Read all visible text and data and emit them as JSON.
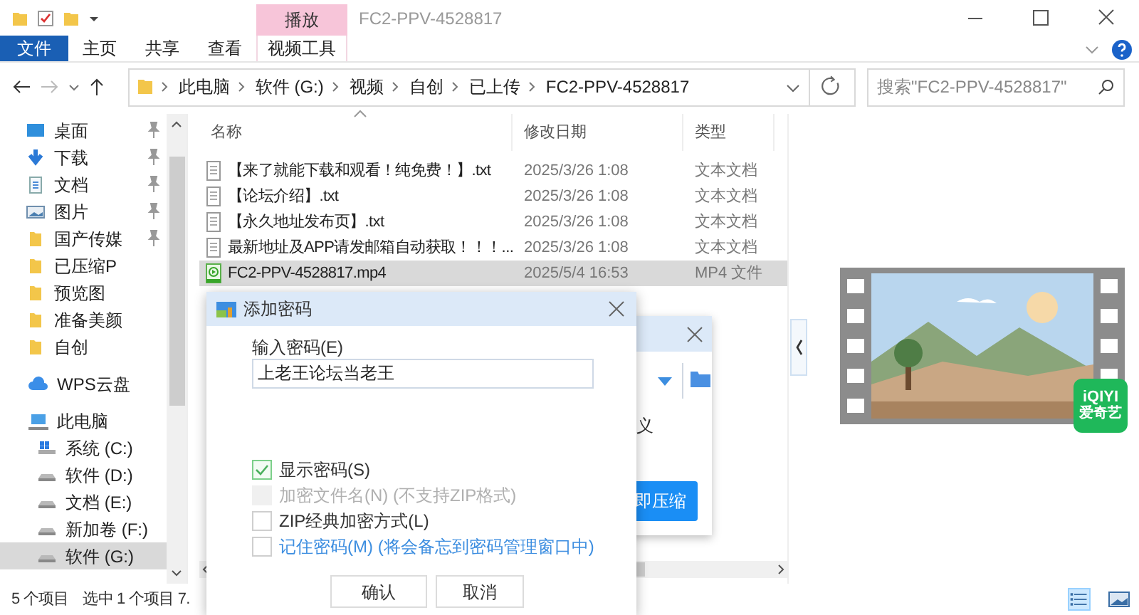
{
  "window": {
    "title": "FC2-PPV-4528817",
    "contextual_group": "播放"
  },
  "ribbon_tabs": [
    {
      "label": "文件",
      "kind": "file",
      "selected": false
    },
    {
      "label": "主页",
      "kind": "tab",
      "selected": false
    },
    {
      "label": "共享",
      "kind": "tab",
      "selected": false
    },
    {
      "label": "查看",
      "kind": "tab",
      "selected": false
    },
    {
      "label": "视频工具",
      "kind": "contextual",
      "selected": false
    }
  ],
  "address": {
    "segments": [
      "此电脑",
      "软件 (G:)",
      "视频",
      "自创",
      "已上传",
      "FC2-PPV-4528817"
    ]
  },
  "search": {
    "placeholder": "搜索\"FC2-PPV-4528817\""
  },
  "sidebar": {
    "items": [
      {
        "label": "桌面",
        "kind": "desktop",
        "pinned": true,
        "selected": false
      },
      {
        "label": "下载",
        "kind": "download",
        "pinned": true,
        "selected": false
      },
      {
        "label": "文档",
        "kind": "document",
        "pinned": true,
        "selected": false
      },
      {
        "label": "图片",
        "kind": "pictures",
        "pinned": true,
        "selected": false
      },
      {
        "label": "国产传媒",
        "kind": "folder",
        "pinned": true,
        "selected": false
      },
      {
        "label": "已压缩P",
        "kind": "folder",
        "pinned": false,
        "selected": false
      },
      {
        "label": "预览图",
        "kind": "folder",
        "pinned": false,
        "selected": false
      },
      {
        "label": "准备美颜",
        "kind": "folder",
        "pinned": false,
        "selected": false
      },
      {
        "label": "自创",
        "kind": "folder",
        "pinned": false,
        "selected": false
      },
      {
        "label": "WPS云盘",
        "kind": "cloud",
        "pinned": false,
        "selected": false
      },
      {
        "label": "此电脑",
        "kind": "pc",
        "pinned": false,
        "selected": false,
        "children": [
          {
            "label": "系统 (C:)",
            "kind": "system-drive",
            "pinned": false,
            "selected": false
          },
          {
            "label": "软件 (D:)",
            "kind": "drive",
            "pinned": false,
            "selected": false
          },
          {
            "label": "文档 (E:)",
            "kind": "drive",
            "pinned": false,
            "selected": false
          },
          {
            "label": "新加卷 (F:)",
            "kind": "drive",
            "pinned": false,
            "selected": false
          },
          {
            "label": "软件 (G:)",
            "kind": "drive",
            "pinned": false,
            "selected": true
          }
        ]
      }
    ]
  },
  "file_list": {
    "columns": [
      "名称",
      "修改日期",
      "类型"
    ],
    "rows": [
      {
        "name": "【来了就能下载和观看！纯免费！】.txt",
        "date": "2025/3/26 1:08",
        "type": "文本文档",
        "kind": "text",
        "selected": false
      },
      {
        "name": "【论坛介绍】.txt",
        "date": "2025/3/26 1:08",
        "type": "文本文档",
        "kind": "text",
        "selected": false
      },
      {
        "name": "【永久地址发布页】.txt",
        "date": "2025/3/26 1:08",
        "type": "文本文档",
        "kind": "text",
        "selected": false
      },
      {
        "name": "最新地址及APP请发邮箱自动获取！！！...",
        "date": "2025/3/26 1:08",
        "type": "文本文档",
        "kind": "text",
        "selected": false
      },
      {
        "name": "FC2-PPV-4528817.mp4",
        "date": "2025/5/4 16:53",
        "type": "MP4 文件",
        "kind": "video",
        "selected": true
      }
    ]
  },
  "preview": {
    "badge": [
      "iQIYI",
      "爱奇艺"
    ]
  },
  "status_bar": {
    "item_count": "5 个项目",
    "selection": "选中 1 个项目 7."
  },
  "back_dialog": {
    "text": "义",
    "button": "即压缩"
  },
  "dialog": {
    "title": "添加密码",
    "password_label": "输入密码(E)",
    "password_value": "上老王论坛当老王",
    "options": [
      {
        "label": "显示密码(S)",
        "kind": "normal",
        "checked": true,
        "disabled": false
      },
      {
        "label": "加密文件名(N) (不支持ZIP格式)",
        "kind": "normal",
        "checked": false,
        "disabled": true
      },
      {
        "label": "ZIP经典加密方式(L)",
        "kind": "normal",
        "checked": false,
        "disabled": false
      },
      {
        "label": "记住密码(M) (将会备忘到密码管理窗口中)",
        "kind": "link",
        "checked": false,
        "disabled": false
      }
    ],
    "buttons": [
      "确认",
      "取消"
    ]
  }
}
